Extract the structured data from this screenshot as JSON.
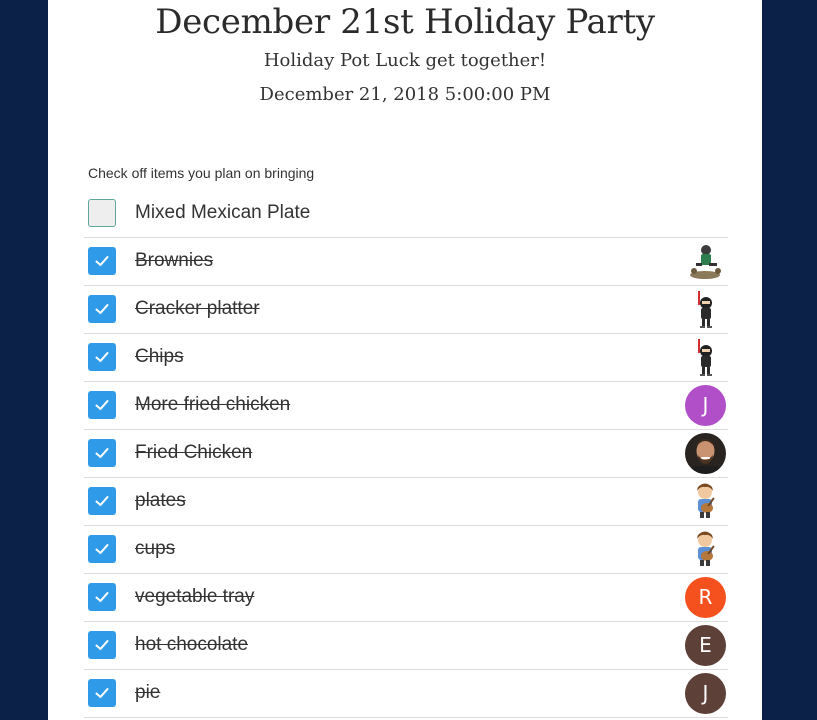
{
  "event": {
    "title": "December 21st Holiday Party",
    "subtitle": "Holiday Pot Luck get together!",
    "datetime": "December 21, 2018 5:00:00 PM"
  },
  "instructions": "Check off items you plan on bringing",
  "items": [
    {
      "label": "Mixed Mexican Plate",
      "checked": false,
      "avatar": null
    },
    {
      "label": "Brownies",
      "checked": true,
      "avatar": {
        "type": "image",
        "icon": "skateboard-character-icon"
      }
    },
    {
      "label": "Cracker platter",
      "checked": true,
      "avatar": {
        "type": "image",
        "icon": "ninja-character-icon"
      }
    },
    {
      "label": "Chips",
      "checked": true,
      "avatar": {
        "type": "image",
        "icon": "ninja-character-icon"
      }
    },
    {
      "label": "More fried chicken",
      "checked": true,
      "avatar": {
        "type": "letter",
        "letter": "J",
        "color": "#b04fc8"
      }
    },
    {
      "label": "Fried Chicken",
      "checked": true,
      "avatar": {
        "type": "image",
        "icon": "user-photo-icon"
      }
    },
    {
      "label": "plates",
      "checked": true,
      "avatar": {
        "type": "image",
        "icon": "guitar-character-icon"
      }
    },
    {
      "label": "cups",
      "checked": true,
      "avatar": {
        "type": "image",
        "icon": "guitar-character-icon"
      }
    },
    {
      "label": "vegetable tray",
      "checked": true,
      "avatar": {
        "type": "letter",
        "letter": "R",
        "color": "#f4511e"
      }
    },
    {
      "label": "hot chocolate",
      "checked": true,
      "avatar": {
        "type": "letter",
        "letter": "E",
        "color": "#5d4037"
      }
    },
    {
      "label": "pie",
      "checked": true,
      "avatar": {
        "type": "letter",
        "letter": "J",
        "color": "#5d4037"
      }
    }
  ],
  "colors": {
    "background": "#0c2148",
    "checkbox_checked": "#2f9be8",
    "checkbox_unchecked_border": "#5ea89a"
  }
}
